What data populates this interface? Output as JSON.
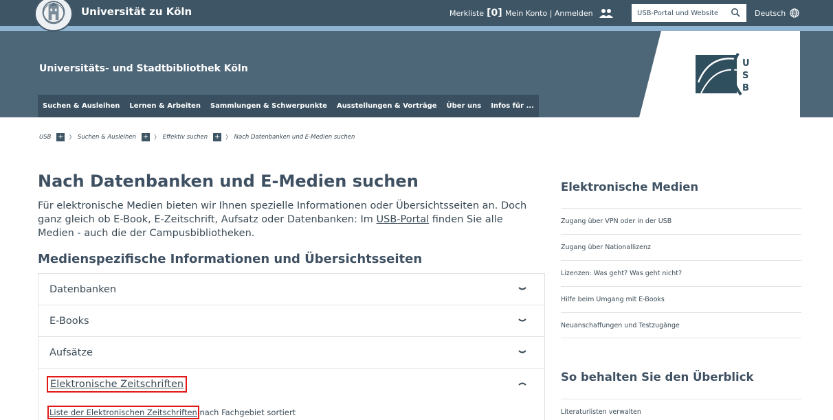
{
  "topbar": {
    "university_name": "Universität zu Köln",
    "merkliste_label": "Merkliste",
    "merkliste_count": "[0]",
    "account_label": "Mein Konto | Anmelden",
    "search_label": "USB-Portal und Website",
    "language_label": "Deutsch"
  },
  "header": {
    "library_title": "Universitäts- und Stadtbibliothek Köln",
    "logo_letters": [
      "U",
      "S",
      "B"
    ],
    "nav": [
      "Suchen & Ausleihen",
      "Lernen & Arbeiten",
      "Sammlungen & Schwerpunkte",
      "Ausstellungen & Vorträge",
      "Über uns",
      "Infos für ..."
    ]
  },
  "breadcrumb": {
    "items": [
      "USB",
      "Suchen & Ausleihen",
      "Effektiv suchen",
      "Nach Datenbanken und E-Medien suchen"
    ]
  },
  "main": {
    "title": "Nach Datenbanken und E-Medien suchen",
    "intro_before": "Für elektronische Medien bieten wir Ihnen spezielle Informationen oder Übersichtsseiten an. Doch ganz gleich ob E-Book, E-Zeitschrift, Aufsatz oder Datenbanken: Im ",
    "intro_link": "USB-Portal",
    "intro_after": " finden Sie alle Medien - auch die der Campusbibliotheken.",
    "subheading": "Medienspezifische Informationen und Übersichtsseiten",
    "accordion": [
      {
        "label": "Datenbanken",
        "state": "collapsed"
      },
      {
        "label": "E-Books",
        "state": "collapsed"
      },
      {
        "label": "Aufsätze",
        "state": "collapsed"
      },
      {
        "label": "Elektronische Zeitschriften",
        "state": "expanded"
      }
    ],
    "expanded_link": "Liste der Elektronischen Zeitschriften",
    "expanded_text": " nach Fachgebiet sortiert"
  },
  "sidebar": {
    "section1_title": "Elektronische Medien",
    "section1_items": [
      "Zugang über VPN oder in der USB",
      "Zugang über Nationallizenz",
      "Lizenzen: Was geht? Was geht nicht?",
      "Hilfe beim Umgang mit E-Books",
      "Neuanschaffungen und Testzugänge"
    ],
    "section2_title": "So behalten Sie den Überblick",
    "section2_items": [
      "Literaturlisten verwalten"
    ]
  },
  "colors": {
    "topbar": "#3e5565",
    "header_band": "#4d6678",
    "accent_strip": "#8fb4d1",
    "highlight_box": "#e01818"
  },
  "icons": [
    "seal-logo",
    "people-icon",
    "search-icon",
    "globe-icon",
    "plus-icon",
    "chevron-down-icon",
    "chevron-up-icon"
  ]
}
